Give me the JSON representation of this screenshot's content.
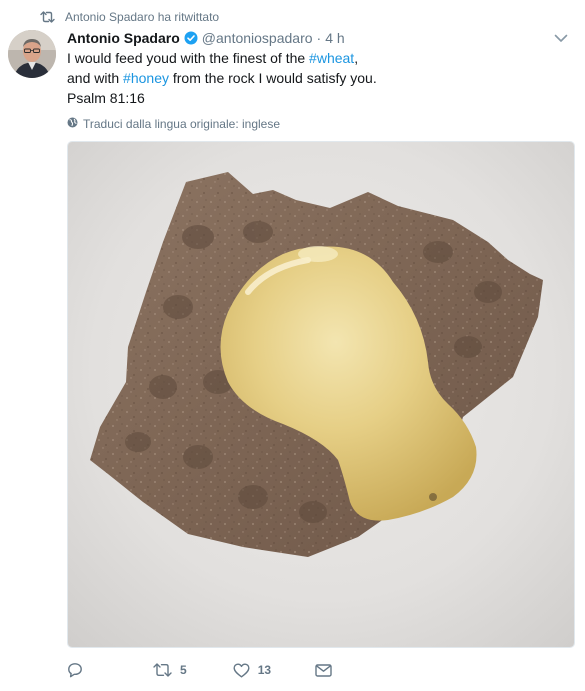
{
  "retweet_context": {
    "text": "Antonio Spadaro ha ritwittato",
    "icon": "retweet-icon"
  },
  "tweet": {
    "author": {
      "display_name": "Antonio Spadaro",
      "handle": "@antoniospadaro",
      "verified": true
    },
    "separator": "·",
    "timestamp": "4 h",
    "text": {
      "line1_a": "I would feed youd with the finest of the ",
      "line1_tag": "#wheat",
      "line1_b": ",",
      "line2_a": "and with ",
      "line2_tag": "#honey",
      "line2_b": " from the rock I would satisfy you.",
      "line3": "Psalm 81:16"
    },
    "translate_label": "Traduci dalla lingua originale: inglese",
    "media": {
      "kind": "photo",
      "subject": "crispbread cracker topped with honey on a white plate"
    },
    "actions": {
      "reply_count": "",
      "retweet_count": "5",
      "like_count": "13"
    }
  },
  "colors": {
    "text_primary": "#14171a",
    "text_secondary": "#657786",
    "link": "#1b95e0",
    "verified_badge": "#1da1f2"
  }
}
